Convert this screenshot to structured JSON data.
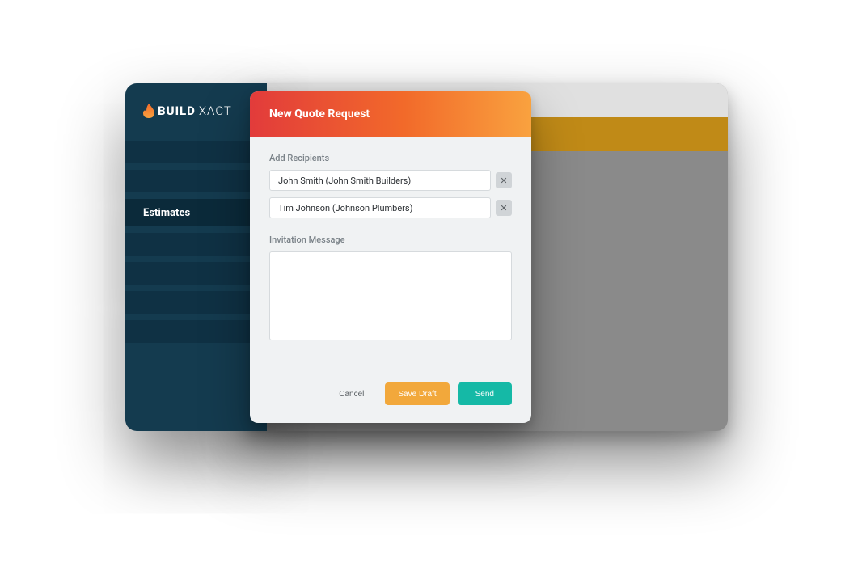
{
  "brand": {
    "a": "BUILD",
    "b": "XACT"
  },
  "sidebar": {
    "active_label": "Estimates"
  },
  "modal": {
    "title": "New Quote Request",
    "recipients_label": "Add Recipients",
    "recipients": [
      {
        "label": "John Smith (John Smith Builders)"
      },
      {
        "label": "Tim Johnson (Johnson Plumbers)"
      }
    ],
    "message_label": "Invitation Message",
    "message_value": "",
    "buttons": {
      "cancel": "Cancel",
      "save_draft": "Save Draft",
      "send": "Send"
    }
  }
}
